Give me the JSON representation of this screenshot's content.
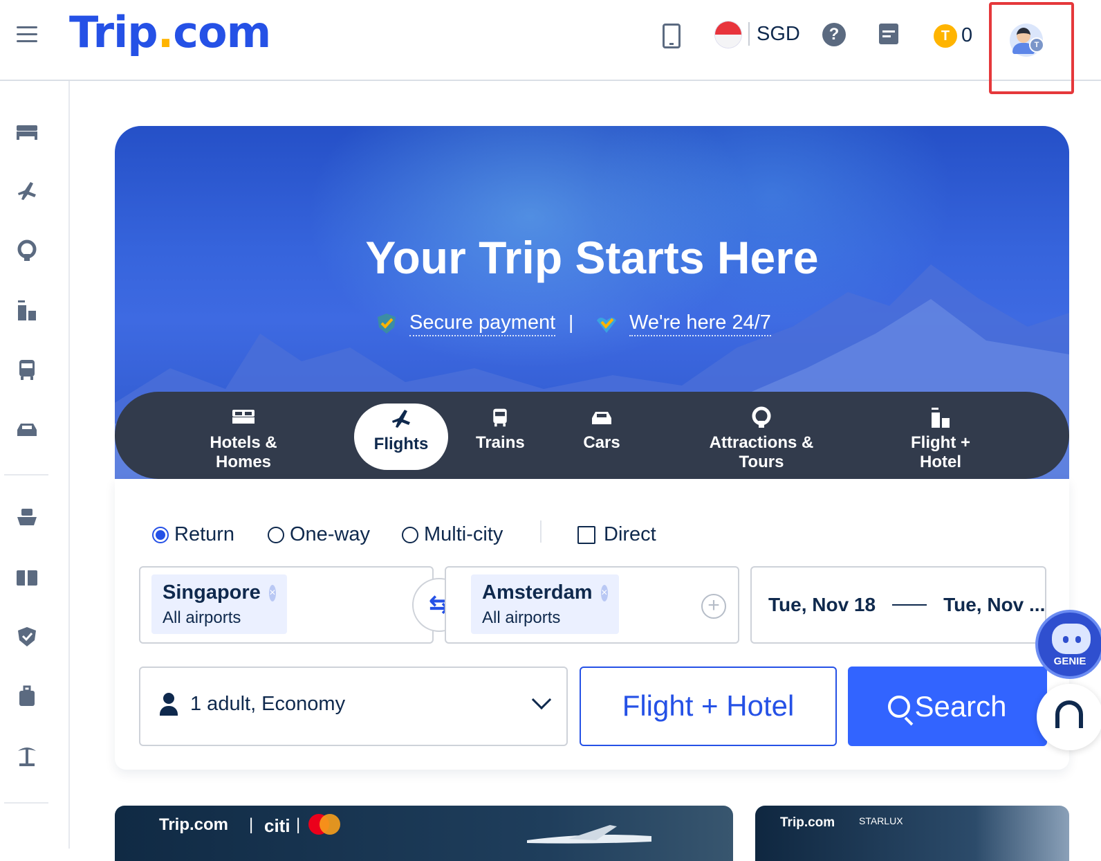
{
  "header": {
    "logo_main": "Trip",
    "logo_dot": ".",
    "logo_suffix": "com",
    "currency": "SGD",
    "help_symbol": "?",
    "coin_symbol": "T",
    "coin_count": "0",
    "avatar_badge": "T",
    "highlight_color": "#e5383b"
  },
  "sidebar": {
    "icons": [
      "hotel-icon",
      "flight-icon",
      "attraction-icon",
      "flight-hotel-icon",
      "train-icon",
      "car-icon",
      "cruise-icon",
      "gift-card-icon",
      "insurance-icon",
      "luggage-icon",
      "island-icon"
    ]
  },
  "hero": {
    "title": "Your Trip Starts Here",
    "feature_1": "Secure payment",
    "separator": "|",
    "feature_2": "We're here 24/7"
  },
  "tabs": [
    {
      "label": "Hotels & Homes",
      "icon": "bed-icon"
    },
    {
      "label": "Flights",
      "icon": "plane-icon",
      "active": true
    },
    {
      "label": "Trains",
      "icon": "train-icon"
    },
    {
      "label": "Cars",
      "icon": "car-icon"
    },
    {
      "label": "Attractions & Tours",
      "icon": "ferris-wheel-icon"
    },
    {
      "label": "Flight + Hotel",
      "icon": "building-icon"
    }
  ],
  "trip_type": {
    "return": "Return",
    "one_way": "One-way",
    "multi_city": "Multi-city",
    "direct": "Direct",
    "selected": "Return"
  },
  "search": {
    "from_city": "Singapore",
    "from_sub": "All airports",
    "to_city": "Amsterdam",
    "to_sub": "All airports",
    "depart_date": "Tue, Nov 18",
    "return_date": "Tue, Nov ...",
    "passengers": "1 adult, Economy",
    "flight_hotel_button": "Flight + Hotel",
    "search_button": "Search",
    "chip_clear": "×",
    "swap_symbol": "⇆",
    "add_symbol": "+"
  },
  "floating": {
    "genie_label": "GENIE"
  },
  "promos": {
    "promo1_brand": "Trip.com",
    "promo1_partner": "citi",
    "promo2_brand": "Trip.com",
    "promo2_partner": "STARLUX"
  },
  "colors": {
    "brand": "#2551e6",
    "search_button": "#3264ff",
    "tab_bar": "#323b4c",
    "text": "#0f294d"
  }
}
